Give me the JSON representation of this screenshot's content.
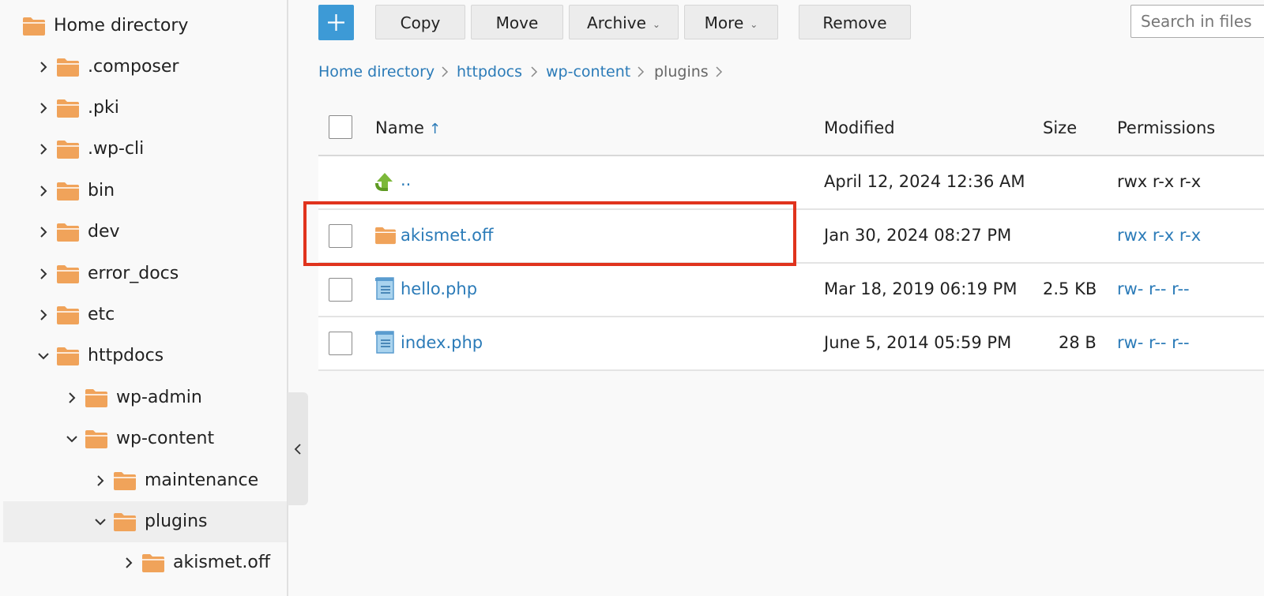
{
  "sidebar": {
    "root": {
      "label": "Home directory"
    },
    "items": [
      {
        "label": ".composer",
        "expanded": false
      },
      {
        "label": ".pki",
        "expanded": false
      },
      {
        "label": ".wp-cli",
        "expanded": false
      },
      {
        "label": "bin",
        "expanded": false
      },
      {
        "label": "dev",
        "expanded": false
      },
      {
        "label": "error_docs",
        "expanded": false
      },
      {
        "label": "etc",
        "expanded": false
      },
      {
        "label": "httpdocs",
        "expanded": true
      },
      {
        "label": "wp-admin",
        "expanded": false
      },
      {
        "label": "wp-content",
        "expanded": true
      },
      {
        "label": "maintenance",
        "expanded": false
      },
      {
        "label": "plugins",
        "expanded": true,
        "selected": true
      },
      {
        "label": "akismet.off",
        "expanded": false
      }
    ]
  },
  "toolbar": {
    "add_icon": "plus-icon",
    "copy": "Copy",
    "move": "Move",
    "archive": "Archive",
    "more": "More",
    "remove": "Remove"
  },
  "search": {
    "placeholder": "Search in files"
  },
  "breadcrumb": [
    "Home directory",
    "httpdocs",
    "wp-content",
    "plugins"
  ],
  "table": {
    "headers": {
      "name": "Name",
      "sort_arrow": "↑",
      "modified": "Modified",
      "size": "Size",
      "permissions": "Permissions"
    },
    "rows": [
      {
        "name": "..",
        "modified": "April 12, 2024 12:36 AM",
        "size": "",
        "permissions": "rwx r-x r-x",
        "icon": "up-arrow-icon"
      },
      {
        "name": "akismet.off",
        "modified": "Jan 30, 2024 08:27 PM",
        "size": "",
        "permissions": "rwx r-x r-x",
        "icon": "folder-icon"
      },
      {
        "name": "hello.php",
        "modified": "Mar 18, 2019 06:19 PM",
        "size": "2.5 KB",
        "permissions": "rw- r-- r--",
        "icon": "file-icon"
      },
      {
        "name": "index.php",
        "modified": "June 5, 2014 05:59 PM",
        "size": "28 B",
        "permissions": "rw- r-- r--",
        "icon": "file-icon"
      }
    ]
  },
  "colors": {
    "accent": "#3d9ad6",
    "link": "#2b7bb8",
    "folder": "#f0a35a",
    "highlight": "#e0331d"
  }
}
